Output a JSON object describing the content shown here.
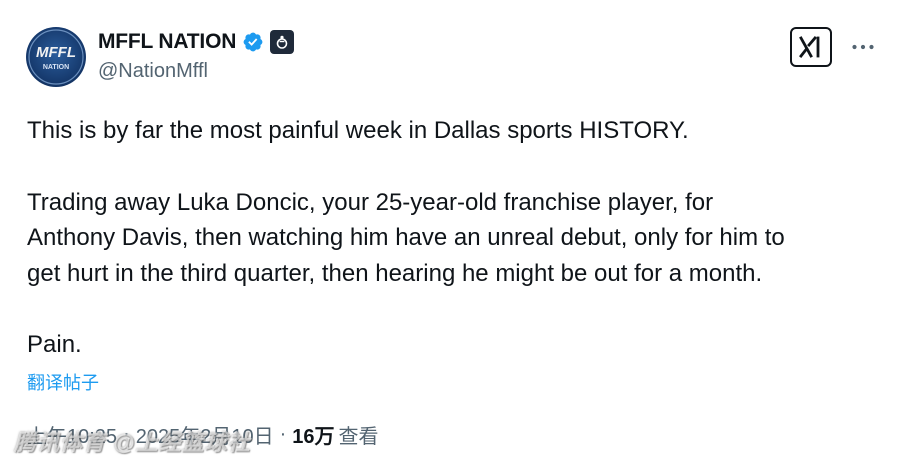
{
  "author": {
    "display_name": "MFFL NATION",
    "handle": "@NationMffl",
    "avatar_text_line1": "MFFL",
    "avatar_text_line2": "NATION",
    "verified_icon": "verified-badge-icon",
    "affiliate_icon": "affiliate-badge-icon"
  },
  "actions": {
    "grok_icon": "grok-xai-icon",
    "more_icon": "more-dots-icon"
  },
  "tweet": {
    "paragraph1": "This is by far the most painful week in Dallas sports HISTORY.",
    "paragraph2_line1": "Trading away Luka Doncic, your 25-year-old franchise player, for",
    "paragraph2_line2": "Anthony Davis, then watching him have an unreal debut, only for him to",
    "paragraph2_line3": "get hurt in the third quarter, then hearing he might be out for a month.",
    "paragraph3": "Pain."
  },
  "translate_label": "翻译帖子",
  "meta": {
    "time": "上午10:25",
    "separator": "·",
    "date": "2025年2月10日",
    "views_count": "16万",
    "views_label": "查看"
  },
  "watermark": "腾讯体育 @上经篮球社",
  "colors": {
    "link_blue": "#1d9bf0",
    "secondary_text": "#536471",
    "primary_text": "#0f1419"
  }
}
